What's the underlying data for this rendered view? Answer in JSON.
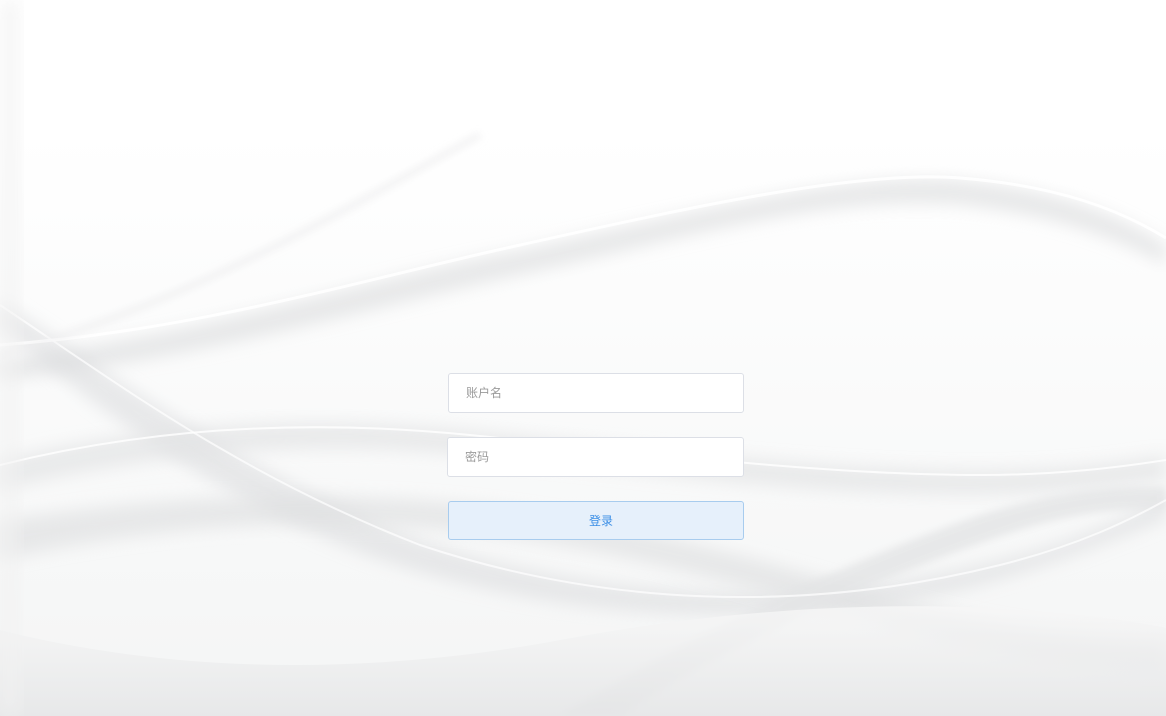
{
  "login": {
    "username": {
      "value": "",
      "placeholder": "账户名"
    },
    "password": {
      "value": "",
      "placeholder": "密码"
    },
    "submit_label": "登录"
  },
  "colors": {
    "background": "#ffffff",
    "wave_shadow": "#d9dadb",
    "button_bg": "#e6f0fb",
    "button_border": "#a8ccee",
    "button_text": "#3a8ee6",
    "field_border": "#dcdfe6"
  }
}
